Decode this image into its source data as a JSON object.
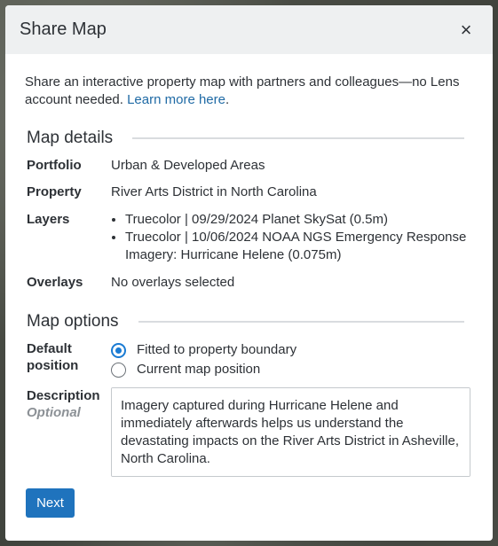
{
  "modal": {
    "title": "Share Map",
    "close_glyph": "×",
    "intro_text": "Share an interactive property map with partners and colleagues—no Lens account needed. ",
    "learn_more": "Learn more here",
    "intro_period": "."
  },
  "details": {
    "heading": "Map details",
    "portfolio_label": "Portfolio",
    "portfolio_value": "Urban & Developed Areas",
    "property_label": "Property",
    "property_value": "River Arts District in North Carolina",
    "layers_label": "Layers",
    "layers": [
      "Truecolor | 09/29/2024 Planet SkySat (0.5m)",
      "Truecolor | 10/06/2024 NOAA NGS Emergency Response Imagery: Hurricane Helene (0.075m)"
    ],
    "overlays_label": "Overlays",
    "overlays_value": "No overlays selected"
  },
  "options": {
    "heading": "Map options",
    "default_position_label_line1": "Default",
    "default_position_label_line2": "position",
    "position_options": [
      {
        "label": "Fitted to property boundary",
        "selected": true
      },
      {
        "label": "Current map position",
        "selected": false
      }
    ],
    "description_label": "Description",
    "description_optional": "Optional",
    "description_value": "Imagery captured during Hurricane Helene and immediately afterwards helps us understand the devastating impacts on the River Arts District in Asheville, North Carolina."
  },
  "actions": {
    "next_label": "Next"
  },
  "colors": {
    "accent": "#1f73bd",
    "link": "#1f6aa5",
    "header_bg": "#eef0f1"
  }
}
